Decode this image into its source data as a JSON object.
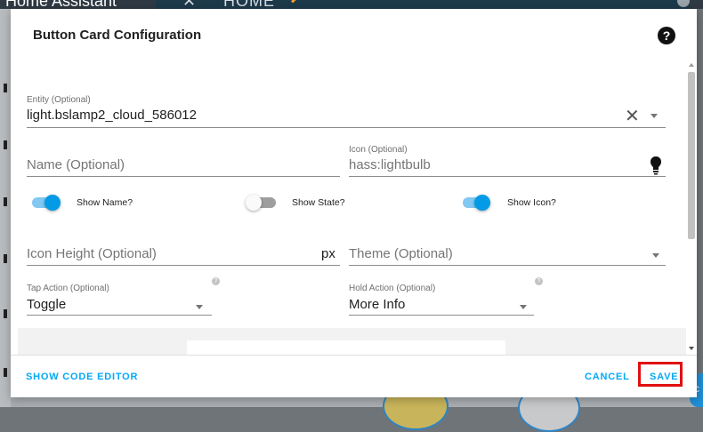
{
  "app": {
    "title": "Home Assistant",
    "view_tab": "HOME"
  },
  "dialog": {
    "title": "Button Card Configuration",
    "entity": {
      "label": "Entity (Optional)",
      "value": "light.bslamp2_cloud_586012"
    },
    "name": {
      "placeholder": "Name (Optional)"
    },
    "icon": {
      "label": "Icon (Optional)",
      "value": "hass:lightbulb"
    },
    "toggles": [
      {
        "label": "Show Name?",
        "on": true
      },
      {
        "label": "Show State?",
        "on": false
      },
      {
        "label": "Show Icon?",
        "on": true
      }
    ],
    "icon_height": {
      "placeholder": "Icon Height (Optional)",
      "suffix": "px"
    },
    "theme": {
      "placeholder": "Theme (Optional)"
    },
    "tap_action": {
      "label": "Tap Action (Optional)",
      "value": "Toggle"
    },
    "hold_action": {
      "label": "Hold Action (Optional)",
      "value": "More Info"
    },
    "footer": {
      "code_editor": "SHOW CODE EDITOR",
      "cancel": "CANCEL",
      "save": "SAVE"
    }
  },
  "colors": {
    "accent": "#03a9f4",
    "toggle_on": "#039be5",
    "highlight": "#e01010"
  },
  "icons": [
    "close-icon",
    "help-icon",
    "lightbulb-icon",
    "chevron-down-icon",
    "pencil-icon"
  ]
}
